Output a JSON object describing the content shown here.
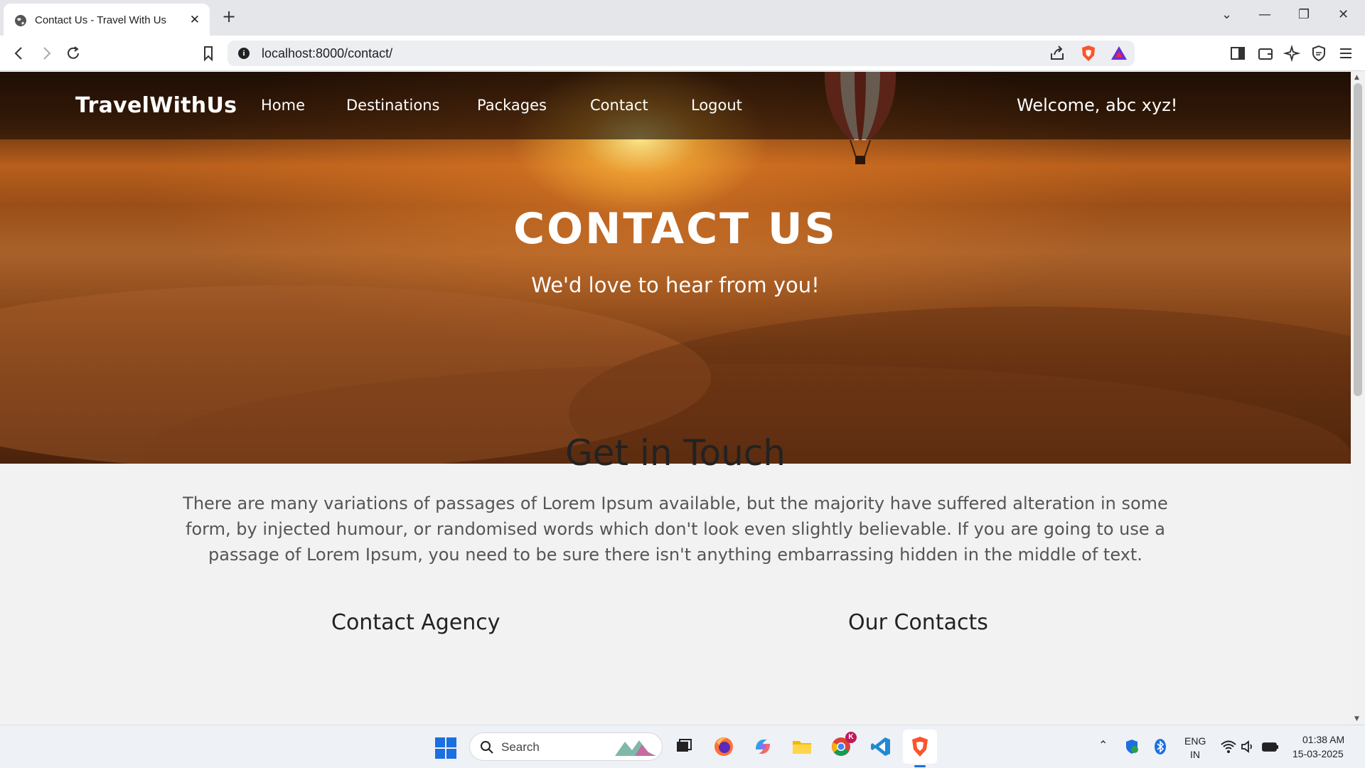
{
  "browser": {
    "tab_title": "Contact Us - Travel With Us",
    "url": "localhost:8000/contact/"
  },
  "nav": {
    "brand": "TravelWithUs",
    "links": [
      "Home",
      "Destinations",
      "Packages",
      "Contact",
      "Logout"
    ],
    "welcome": "Welcome, abc xyz!"
  },
  "hero": {
    "title": "CONTACT US",
    "subtitle": "We'd love to hear from you!"
  },
  "section": {
    "heading": "Get in Touch",
    "text": "There are many variations of passages of Lorem Ipsum available, but the majority have suffered alteration in some form, by injected humour, or randomised words which don't look even slightly believable. If you are going to use a passage of Lorem Ipsum, you need to be sure there isn't anything embarrassing hidden in the middle of text.",
    "col_left": "Contact Agency",
    "col_right": "Our Contacts"
  },
  "taskbar": {
    "search_label": "Search",
    "lang_line1": "ENG",
    "lang_line2": "IN",
    "time": "01:38 AM",
    "date": "15-03-2025",
    "chrome_badge": "K"
  },
  "icons": {
    "tab_favicon": "globe-icon",
    "brave": "brave-lion-icon"
  },
  "colors": {
    "accent_blue": "#1b6fe0",
    "brave_orange": "#fb542b"
  }
}
